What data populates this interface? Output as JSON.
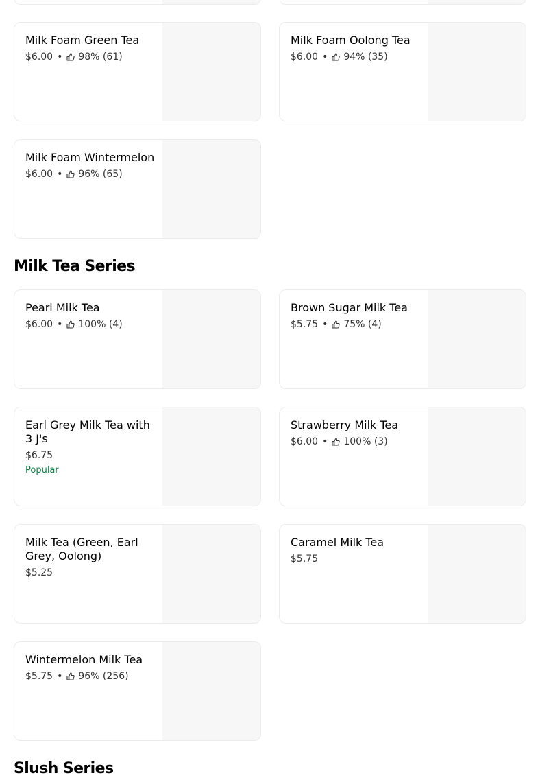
{
  "milk_foam": {
    "items": [
      {
        "name": "Milk Foam Green Tea",
        "price": "$6.00",
        "sep": "•",
        "rating": "98% (61)"
      },
      {
        "name": "Milk Foam Oolong Tea",
        "price": "$6.00",
        "sep": "•",
        "rating": "94% (35)"
      },
      {
        "name": "Milk Foam Wintermelon",
        "price": "$6.00",
        "sep": "•",
        "rating": "96% (65)"
      }
    ]
  },
  "milk_tea": {
    "title": "Milk Tea Series",
    "items": [
      {
        "name": "Pearl Milk Tea",
        "price": "$6.00",
        "sep": "•",
        "rating": "100% (4)"
      },
      {
        "name": "Brown Sugar Milk Tea",
        "price": "$5.75",
        "sep": "•",
        "rating": "75% (4)"
      },
      {
        "name": "Earl Grey Milk Tea with 3 J's",
        "price": "$6.75",
        "badge": "Popular"
      },
      {
        "name": "Strawberry Milk Tea",
        "price": "$6.00",
        "sep": "•",
        "rating": "100% (3)"
      },
      {
        "name": "Milk Tea (Green, Earl Grey, Oolong)",
        "price": "$5.25"
      },
      {
        "name": "Caramel Milk Tea",
        "price": "$5.75"
      },
      {
        "name": "Wintermelon Milk Tea",
        "price": "$5.75",
        "sep": "•",
        "rating": "96% (256)"
      }
    ]
  },
  "slush": {
    "title": "Slush Series"
  },
  "icons": {
    "rating": "thumbs-up-icon"
  },
  "colors": {
    "popular_badge": "#0e8345",
    "card_border": "#ebebeb",
    "image_placeholder": "#f7f7f7"
  }
}
